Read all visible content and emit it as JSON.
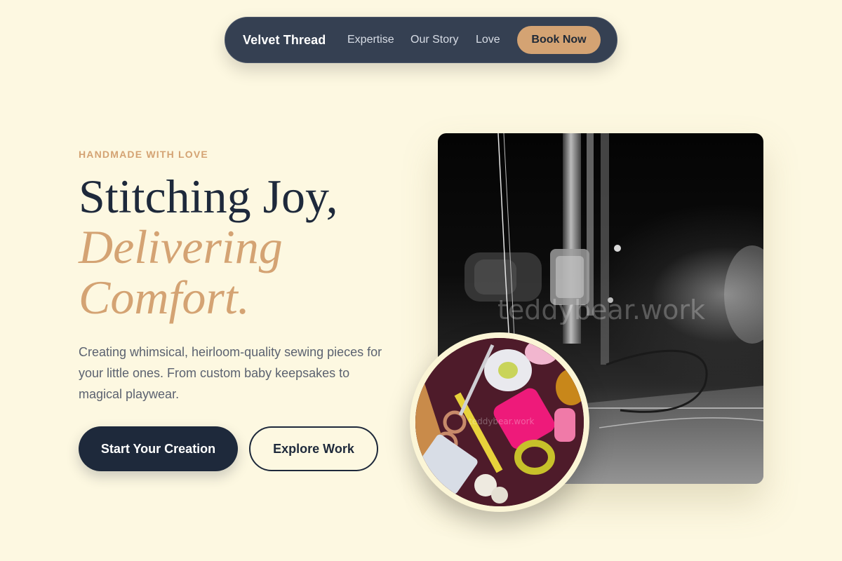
{
  "nav": {
    "brand": "Velvet Thread",
    "links": [
      "Expertise",
      "Our Story",
      "Love"
    ],
    "cta_label": "Book Now"
  },
  "hero": {
    "eyebrow": "HANDMADE WITH LOVE",
    "headline_line1": "Stitching Joy,",
    "headline_accent_line1": "Delivering",
    "headline_accent_line2": "Comfort.",
    "description": "Creating whimsical, heirloom-quality sewing pieces for your little ones. From custom baby keepsakes to magical playwear.",
    "primary_button": "Start Your Creation",
    "secondary_button": "Explore Work"
  },
  "images": {
    "main_watermark": "teddybear.work",
    "circle_watermark": "teddybear.work"
  },
  "colors": {
    "background": "#fdf8e1",
    "nav_bg": "#354052",
    "accent": "#d4a373",
    "dark": "#1e293b"
  }
}
